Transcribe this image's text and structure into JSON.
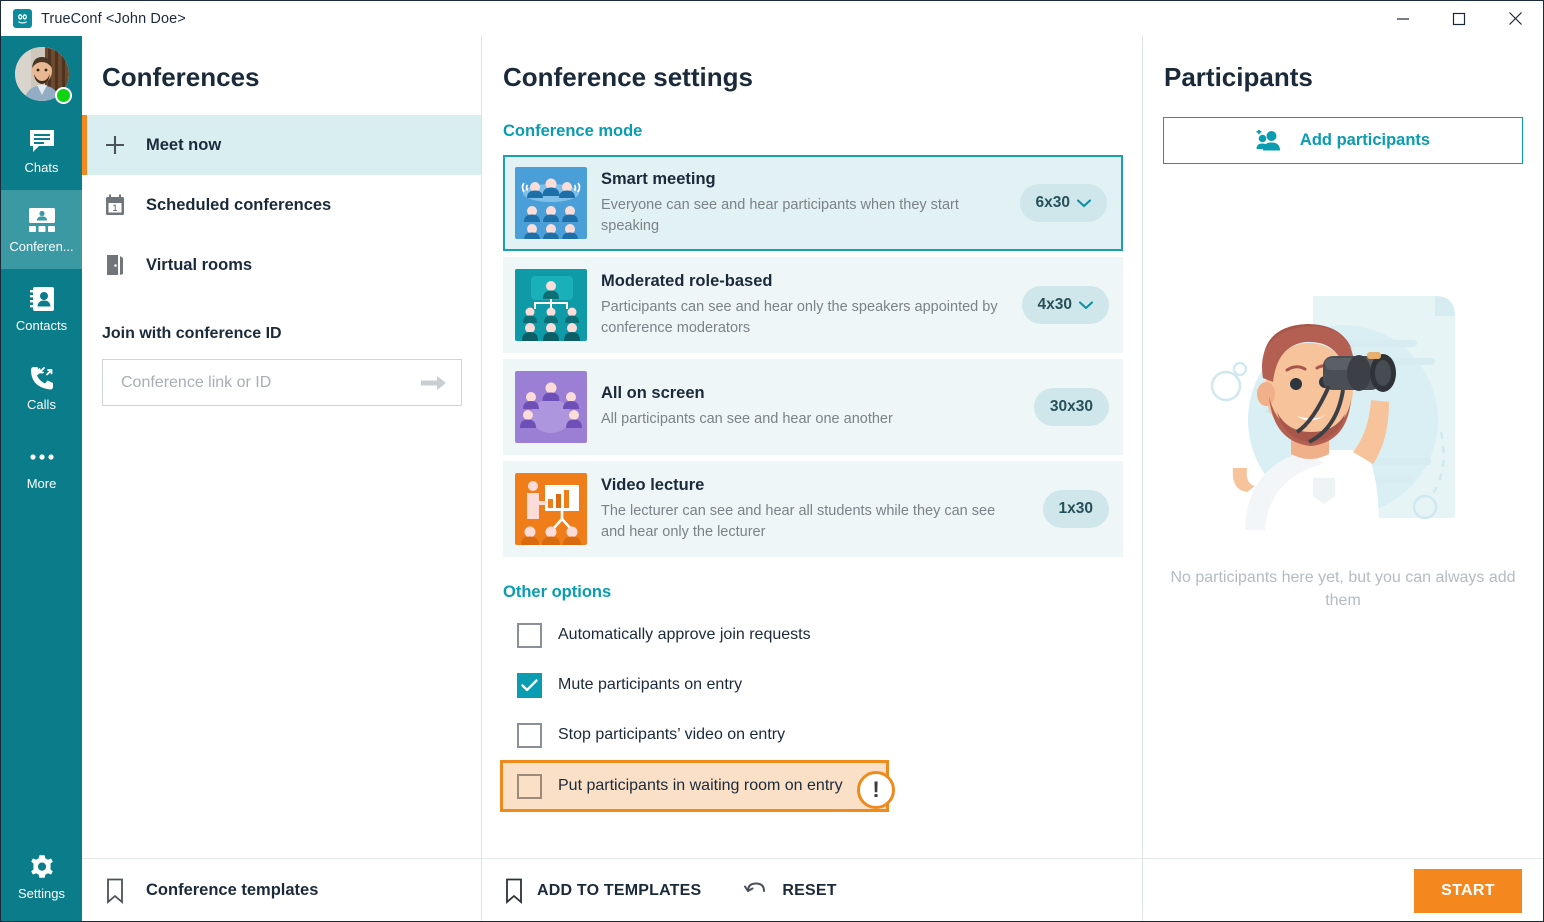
{
  "window": {
    "title": "TrueConf <John Doe>",
    "logo_icon": "trueconf-logo-icon",
    "minimize_icon": "minimize-icon",
    "maximize_icon": "maximize-icon",
    "close_icon": "close-icon"
  },
  "rail": {
    "avatar_name": "user-avatar",
    "presence": "online",
    "items": [
      {
        "label": "Chats",
        "icon": "chat-bubble-icon",
        "active": false
      },
      {
        "label": "Conferen...",
        "icon": "conference-icon",
        "active": true
      },
      {
        "label": "Contacts",
        "icon": "contacts-book-icon",
        "active": false
      },
      {
        "label": "Calls",
        "icon": "phone-calls-icon",
        "active": false
      },
      {
        "label": "More",
        "icon": "ellipsis-icon",
        "active": false
      }
    ],
    "settings": {
      "label": "Settings",
      "icon": "gear-icon"
    }
  },
  "conferences": {
    "title": "Conferences",
    "nav": [
      {
        "label": "Meet now",
        "icon": "plus-icon",
        "active": true
      },
      {
        "label": "Scheduled conferences",
        "icon": "calendar-icon",
        "active": false
      },
      {
        "label": "Virtual rooms",
        "icon": "door-icon",
        "active": false
      }
    ],
    "join": {
      "label": "Join with conference ID",
      "placeholder": "Conference link or ID",
      "value": "",
      "submit_icon": "arrow-right-icon"
    },
    "templates": {
      "label": "Conference templates",
      "icon": "bookmark-icon"
    }
  },
  "settings": {
    "title": "Conference settings",
    "mode_section_label": "Conference mode",
    "modes": [
      {
        "name": "Smart meeting",
        "desc": "Everyone can see and hear participants when they start speaking",
        "pill": "6x30",
        "has_chevron": true,
        "selected": true,
        "thumb": "smart-meeting-thumb",
        "thumb_bg": "#4a9fd8"
      },
      {
        "name": "Moderated role-based",
        "desc": "Participants can see and hear only the speakers appointed by conference moderators",
        "pill": "4x30",
        "has_chevron": true,
        "selected": false,
        "thumb": "moderated-role-based-thumb",
        "thumb_bg": "#0e9aa7"
      },
      {
        "name": "All on screen",
        "desc": "All participants can see and hear one another",
        "pill": "30x30",
        "has_chevron": false,
        "selected": false,
        "thumb": "all-on-screen-thumb",
        "thumb_bg": "#9b7fd4"
      },
      {
        "name": "Video lecture",
        "desc": "The lecturer can see and hear all students while they can see and hear only the lecturer",
        "pill": "1x30",
        "has_chevron": false,
        "selected": false,
        "thumb": "video-lecture-thumb",
        "thumb_bg": "#ef7d19"
      }
    ],
    "other_options_label": "Other options",
    "options": [
      {
        "label": "Automatically approve join requests",
        "checked": false,
        "highlight": false
      },
      {
        "label": "Mute participants on entry",
        "checked": true,
        "highlight": false
      },
      {
        "label": "Stop participants’ video on entry",
        "checked": false,
        "highlight": false
      },
      {
        "label": "Put participants in waiting room on entry",
        "checked": false,
        "highlight": true
      }
    ],
    "warning_badge": "!",
    "bottom": {
      "add_to_templates": "ADD TO TEMPLATES",
      "add_to_templates_icon": "bookmark-icon",
      "reset": "RESET",
      "reset_icon": "undo-icon"
    }
  },
  "participants": {
    "title": "Participants",
    "add_button": "Add participants",
    "add_icon": "add-person-icon",
    "empty_text": "No participants here yet, but you can always add them",
    "illustration": "man-with-binoculars-illustration",
    "start_button": "START"
  },
  "colors": {
    "brand_teal": "#0a7c8a",
    "accent_teal": "#0a9cb0",
    "accent_orange": "#f4881f",
    "warning_orange": "#ef8a1d",
    "highlight_bg": "#fae0c7",
    "card_bg": "#eef6f7",
    "selected_card_bg": "#e2f1f3",
    "nav_active_bg": "#d8eef1"
  }
}
